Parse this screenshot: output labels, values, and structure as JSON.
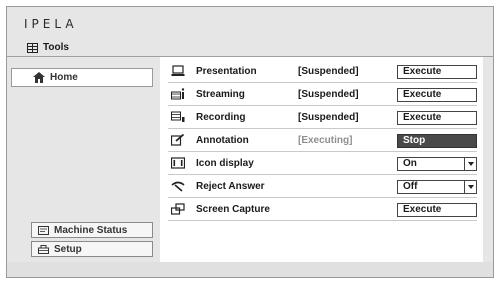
{
  "app": {
    "logo_text": "IPELA",
    "section_title": "Tools"
  },
  "sidebar": {
    "home_label": "Home",
    "machine_status_label": "Machine Status",
    "setup_label": "Setup"
  },
  "rows": [
    {
      "name": "Presentation",
      "status": "[Suspended]",
      "control": "Execute",
      "icon": "presentation-icon"
    },
    {
      "name": "Streaming",
      "status": "[Suspended]",
      "control": "Execute",
      "icon": "streaming-icon"
    },
    {
      "name": "Recording",
      "status": "[Suspended]",
      "control": "Execute",
      "icon": "recording-icon"
    },
    {
      "name": "Annotation",
      "status": "[Executing]",
      "control": "Stop",
      "icon": "annotation-icon"
    },
    {
      "name": "Icon display",
      "status": "",
      "control": "On",
      "icon": "icon-display-icon"
    },
    {
      "name": "Reject Answer",
      "status": "",
      "control": "Off",
      "icon": "reject-answer-icon"
    },
    {
      "name": "Screen Capture",
      "status": "",
      "control": "Execute",
      "icon": "screen-capture-icon"
    }
  ],
  "colors": {
    "frame_bg": "#e6e6e6",
    "panel_bg": "#ffffff",
    "stop_button_bg": "#4a4a4a"
  }
}
